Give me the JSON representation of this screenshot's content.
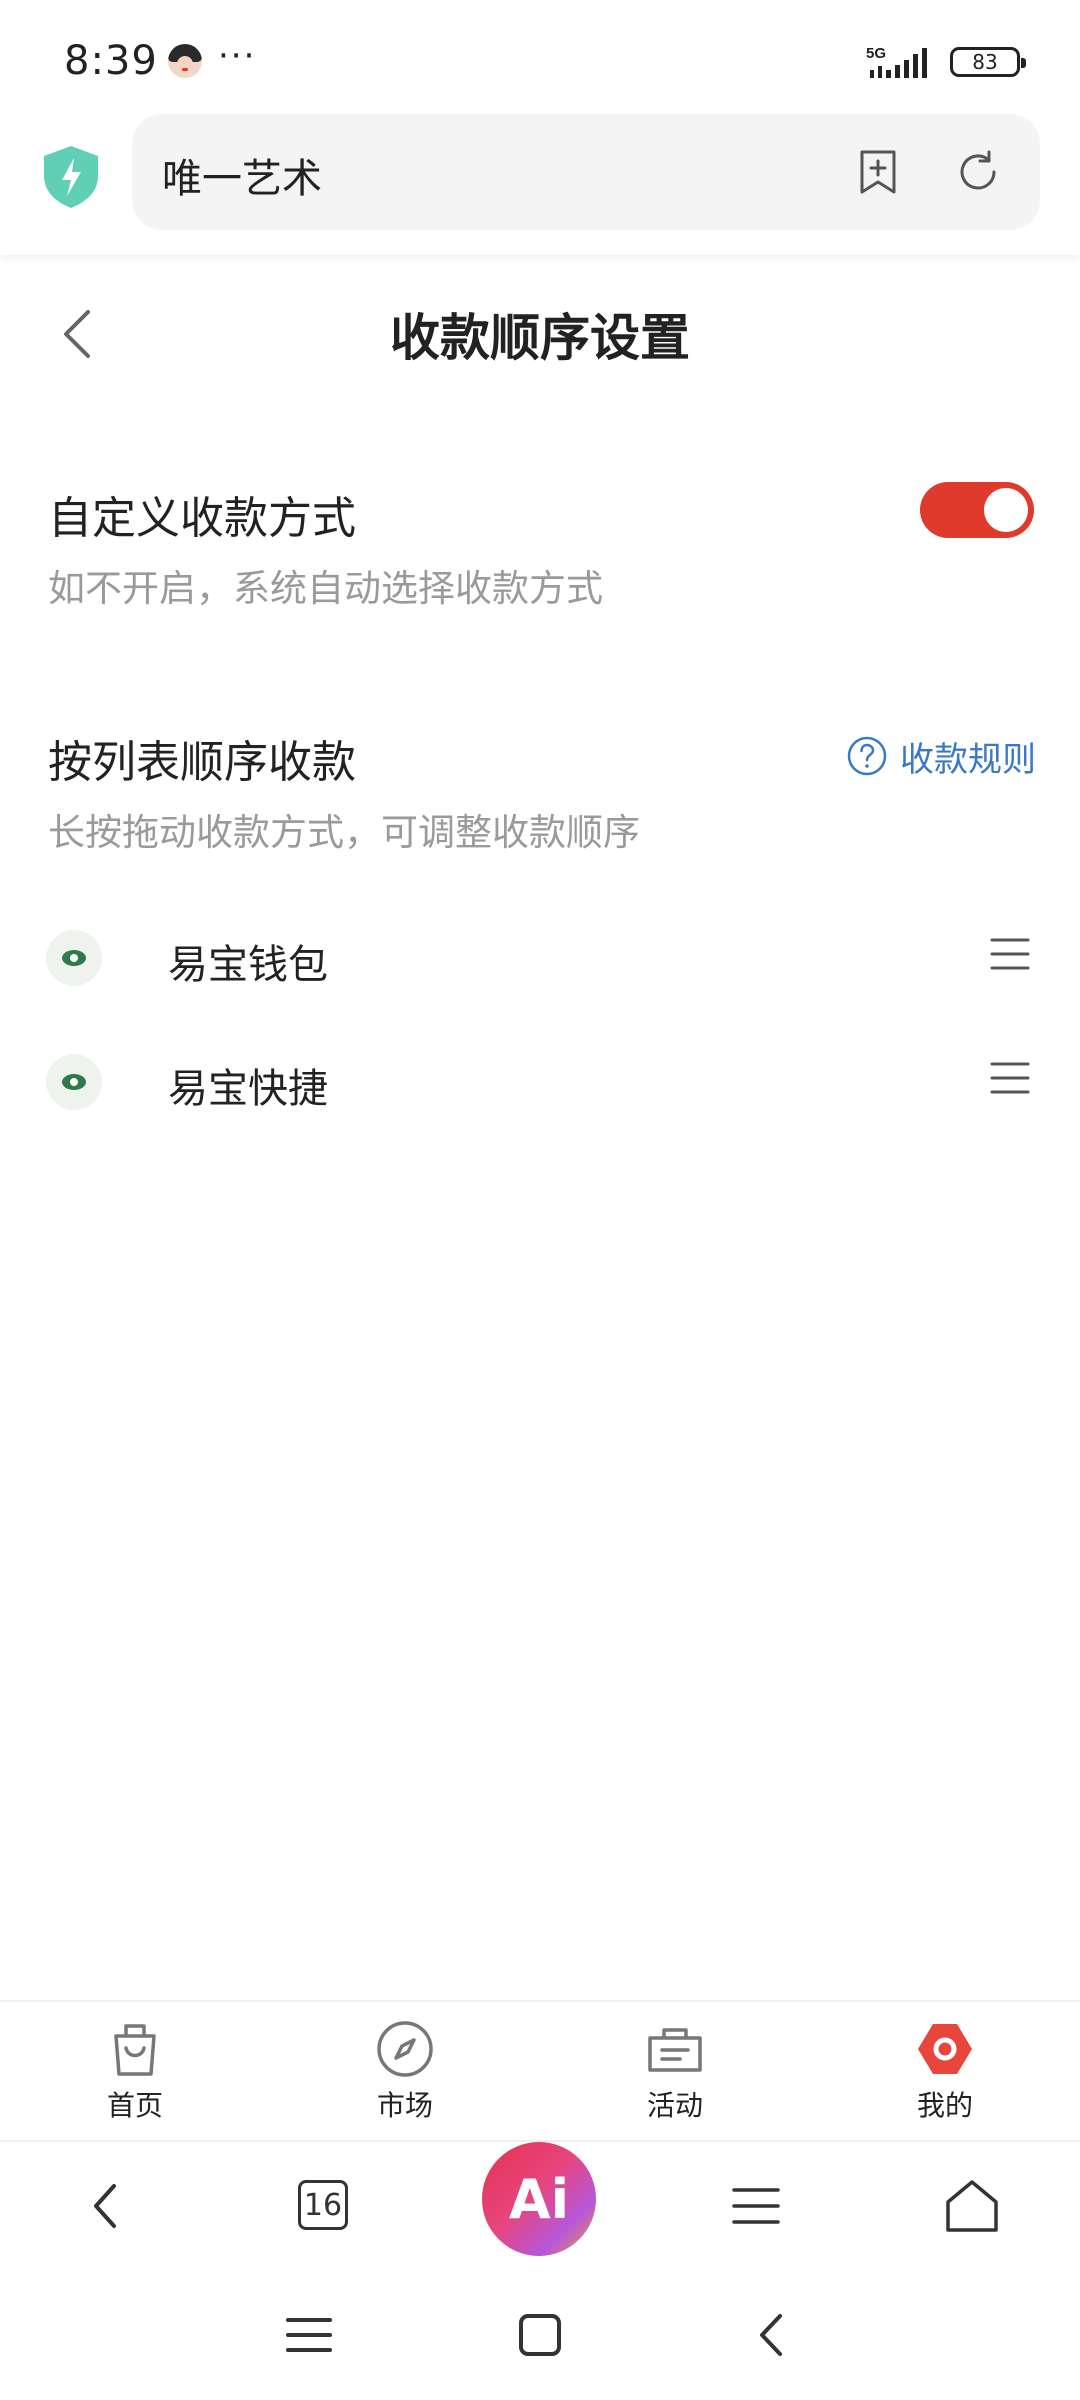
{
  "status_bar": {
    "time": "8:39",
    "more": "···",
    "network": "5G",
    "battery": "83"
  },
  "url_bar": {
    "text": "唯一艺术"
  },
  "page": {
    "title": "收款顺序设置"
  },
  "custom_payment": {
    "title": "自定义收款方式",
    "subtitle": "如不开启，系统自动选择收款方式",
    "enabled": true
  },
  "list_order": {
    "title": "按列表顺序收款",
    "subtitle": "长按拖动收款方式，可调整收款顺序",
    "rules_link": "收款规则"
  },
  "payment_methods": [
    {
      "name": "易宝钱包"
    },
    {
      "name": "易宝快捷"
    }
  ],
  "tab_bar": {
    "items": [
      {
        "label": "首页",
        "icon": "shopping-bag-icon"
      },
      {
        "label": "市场",
        "icon": "compass-icon"
      },
      {
        "label": "活动",
        "icon": "ticket-icon"
      },
      {
        "label": "我的",
        "icon": "profile-hexagon-icon"
      }
    ]
  },
  "browser_toolbar": {
    "tab_count": "16",
    "ai_label": "Ai"
  },
  "colors": {
    "accent_red": "#e03a2d",
    "link_blue": "#3a78c8",
    "shield_teal": "#5fcfb6",
    "muted_text": "#9a9a9a"
  }
}
